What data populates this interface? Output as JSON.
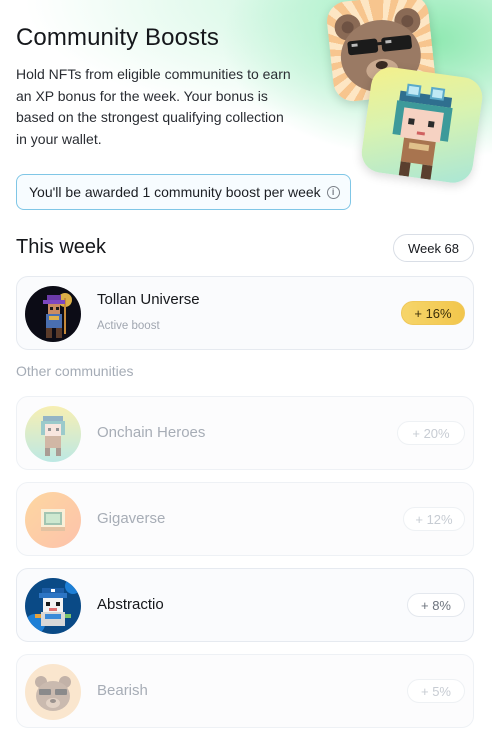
{
  "hero": {
    "title": "Community Boosts",
    "description": "Hold NFTs from eligible communities to earn an XP bonus for the week. Your bonus is based on the strongest qualifying collection in your wallet."
  },
  "award_notice": {
    "text": "You'll be awarded 1 community boost per week",
    "icon": "info-icon"
  },
  "this_week": {
    "heading": "This week",
    "week_label": "Week 68",
    "active": {
      "name": "Tollan Universe",
      "status": "Active boost",
      "boost": "+ 16%"
    }
  },
  "other": {
    "heading": "Other communities",
    "items": [
      {
        "name": "Onchain Heroes",
        "boost": "+ 20%"
      },
      {
        "name": "Gigaverse",
        "boost": "+ 12%"
      },
      {
        "name": "Abstractio",
        "boost": "+ 8%"
      },
      {
        "name": "Bearish",
        "boost": "+ 5%"
      }
    ]
  },
  "colors": {
    "accent_gold": "#f2c64c",
    "info_border": "#7fc6e6",
    "hero_green": "#8ee8b0"
  }
}
